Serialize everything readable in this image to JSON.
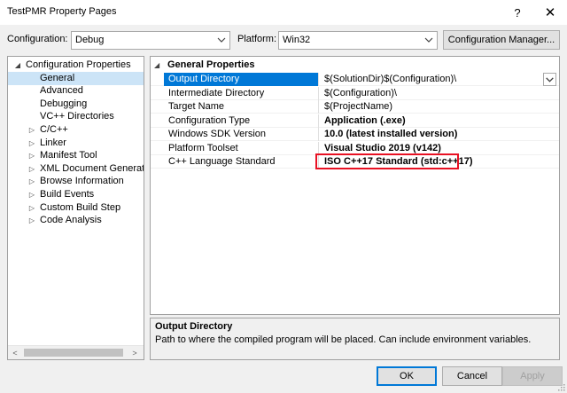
{
  "window": {
    "title": "TestPMR Property Pages"
  },
  "title_buttons": {
    "help": "?",
    "close": "✕"
  },
  "config_row": {
    "configuration_label": "Configuration:",
    "configuration_value": "Debug",
    "platform_label": "Platform:",
    "platform_value": "Win32",
    "manager_button": "Configuration Manager..."
  },
  "tree": {
    "items": [
      {
        "label": "Configuration Properties",
        "expander": "◢",
        "selected": false
      },
      {
        "label": "General",
        "expander": "",
        "selected": true
      },
      {
        "label": "Advanced",
        "expander": "",
        "selected": false
      },
      {
        "label": "Debugging",
        "expander": "",
        "selected": false
      },
      {
        "label": "VC++ Directories",
        "expander": "",
        "selected": false
      },
      {
        "label": "C/C++",
        "expander": "▷",
        "selected": false
      },
      {
        "label": "Linker",
        "expander": "▷",
        "selected": false
      },
      {
        "label": "Manifest Tool",
        "expander": "▷",
        "selected": false
      },
      {
        "label": "XML Document Generator",
        "expander": "▷",
        "selected": false
      },
      {
        "label": "Browse Information",
        "expander": "▷",
        "selected": false
      },
      {
        "label": "Build Events",
        "expander": "▷",
        "selected": false
      },
      {
        "label": "Custom Build Step",
        "expander": "▷",
        "selected": false
      },
      {
        "label": "Code Analysis",
        "expander": "▷",
        "selected": false
      }
    ],
    "scroll_left": "<",
    "scroll_right": ">"
  },
  "grid": {
    "category_toggle": "◢",
    "category": "General Properties",
    "rows": [
      {
        "name": "Output Directory",
        "value": "$(SolutionDir)$(Configuration)\\",
        "bold": false,
        "selected": true
      },
      {
        "name": "Intermediate Directory",
        "value": "$(Configuration)\\",
        "bold": false,
        "selected": false
      },
      {
        "name": "Target Name",
        "value": "$(ProjectName)",
        "bold": false,
        "selected": false
      },
      {
        "name": "Configuration Type",
        "value": "Application (.exe)",
        "bold": true,
        "selected": false
      },
      {
        "name": "Windows SDK Version",
        "value": "10.0 (latest installed version)",
        "bold": true,
        "selected": false
      },
      {
        "name": "Platform Toolset",
        "value": "Visual Studio 2019 (v142)",
        "bold": true,
        "selected": false
      },
      {
        "name": "C++ Language Standard",
        "value": "ISO C++17 Standard (std:c++17)",
        "bold": true,
        "selected": false
      }
    ]
  },
  "description": {
    "title": "Output Directory",
    "text": "Path to where the compiled program will be placed. Can include environment variables."
  },
  "buttons": {
    "ok": "OK",
    "cancel": "Cancel",
    "apply": "Apply"
  },
  "colors": {
    "selection": "#0078d7",
    "tree_selection": "#cce4f7",
    "highlight_border": "#e81123"
  }
}
